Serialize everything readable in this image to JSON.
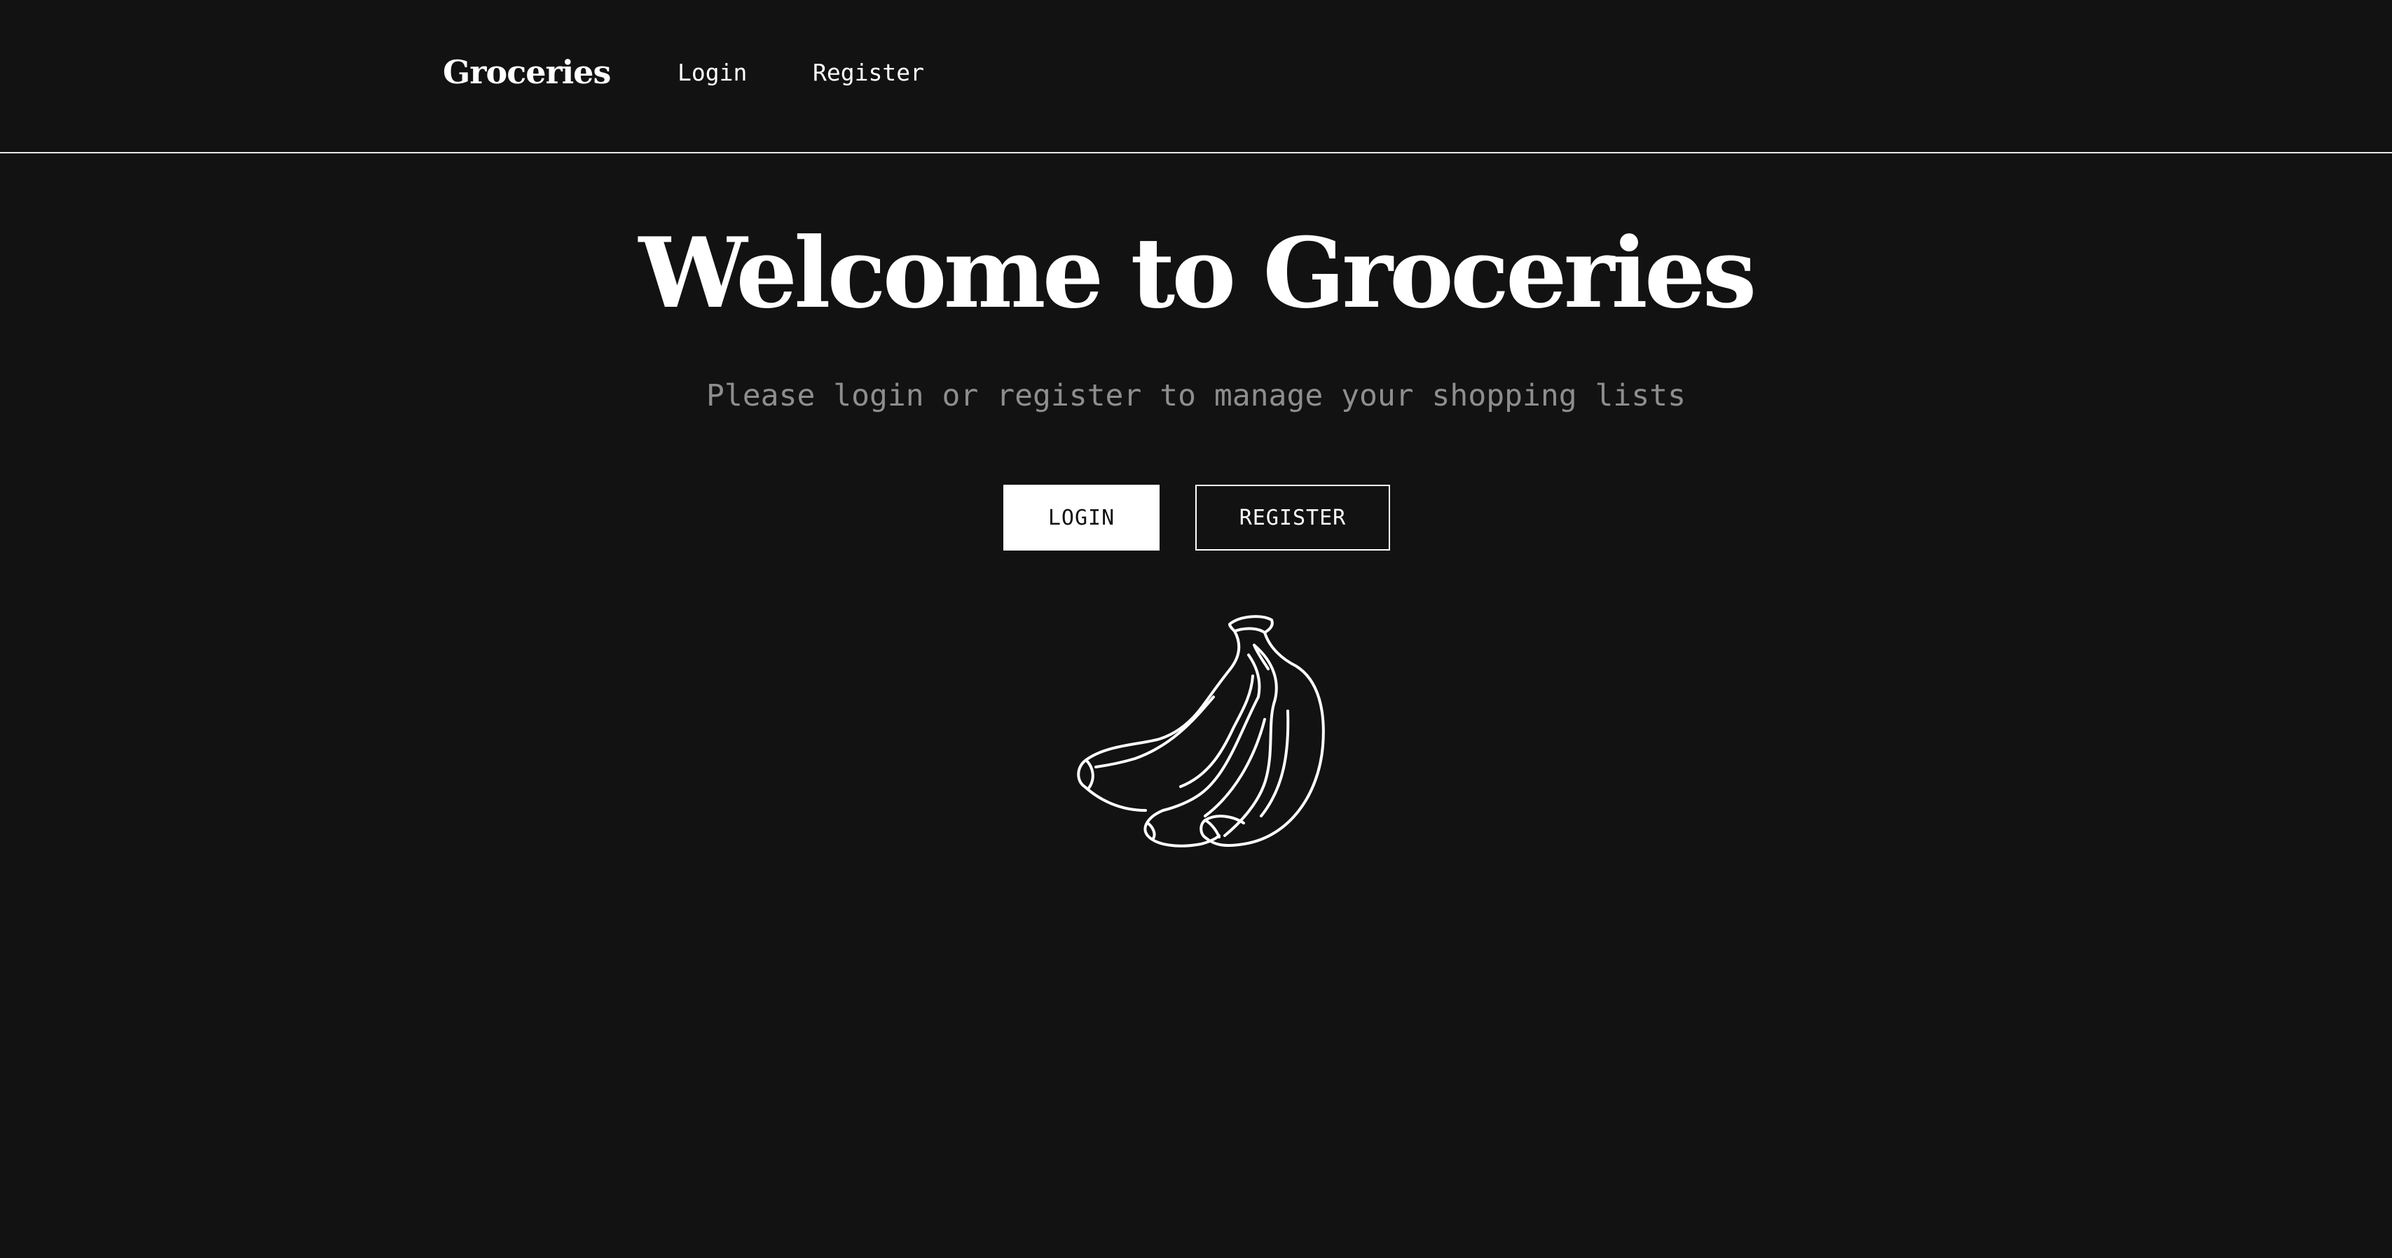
{
  "header": {
    "brand": "Groceries",
    "nav": {
      "login_label": "Login",
      "register_label": "Register"
    }
  },
  "hero": {
    "title": "Welcome to Groceries",
    "subtitle": "Please login or register to manage your shopping lists",
    "buttons": {
      "login_label": "LOGIN",
      "register_label": "REGISTER"
    },
    "illustration_icon": "banana-bunch-icon"
  },
  "colors": {
    "background": "#121212",
    "text": "#ffffff",
    "muted_text": "#8e8e8e",
    "divider": "#e6e6e6"
  }
}
